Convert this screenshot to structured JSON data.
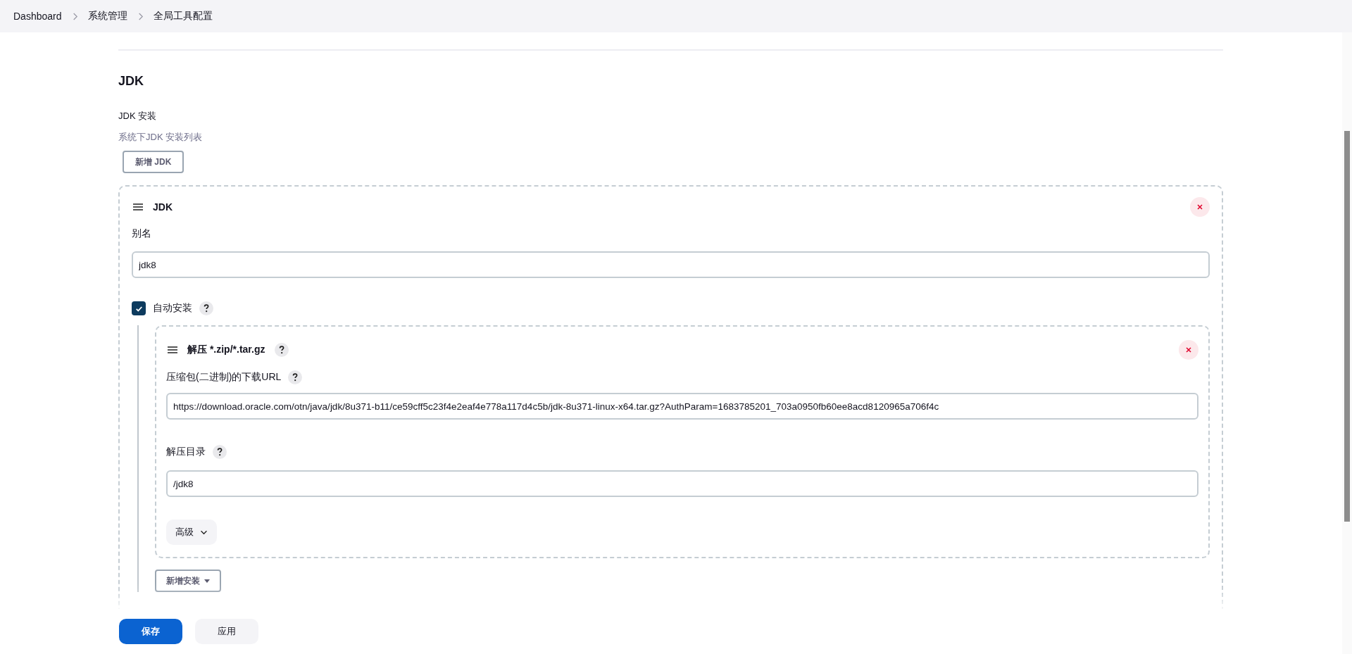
{
  "breadcrumbs": [
    {
      "label": "Dashboard"
    },
    {
      "label": "系统管理"
    },
    {
      "label": "全局工具配置"
    }
  ],
  "section": {
    "title": "JDK",
    "field_label": "JDK 安装",
    "description": "系统下JDK 安装列表",
    "add_button": "新增 JDK"
  },
  "jdk": {
    "title": "JDK",
    "alias_label": "别名",
    "alias_value": "jdk8",
    "auto_install": {
      "label": "自动安装",
      "checked": true
    },
    "installer": {
      "title": "解压 *.zip/*.tar.gz",
      "url_label": "压缩包(二进制)的下载URL",
      "url_value": "https://download.oracle.com/otn/java/jdk/8u371-b11/ce59cff5c23f4e2eaf4e778a117d4c5b/jdk-8u371-linux-x64.tar.gz?AuthParam=1683785201_703a0950fb60ee8acd8120965a706f4c",
      "dir_label": "解压目录",
      "dir_value": "/jdk8",
      "advanced_button": "高级"
    },
    "add_installer_button": "新增安装"
  },
  "actions": [
    {
      "label": "保存",
      "kind": "primary"
    },
    {
      "label": "应用",
      "kind": "secondary"
    }
  ]
}
